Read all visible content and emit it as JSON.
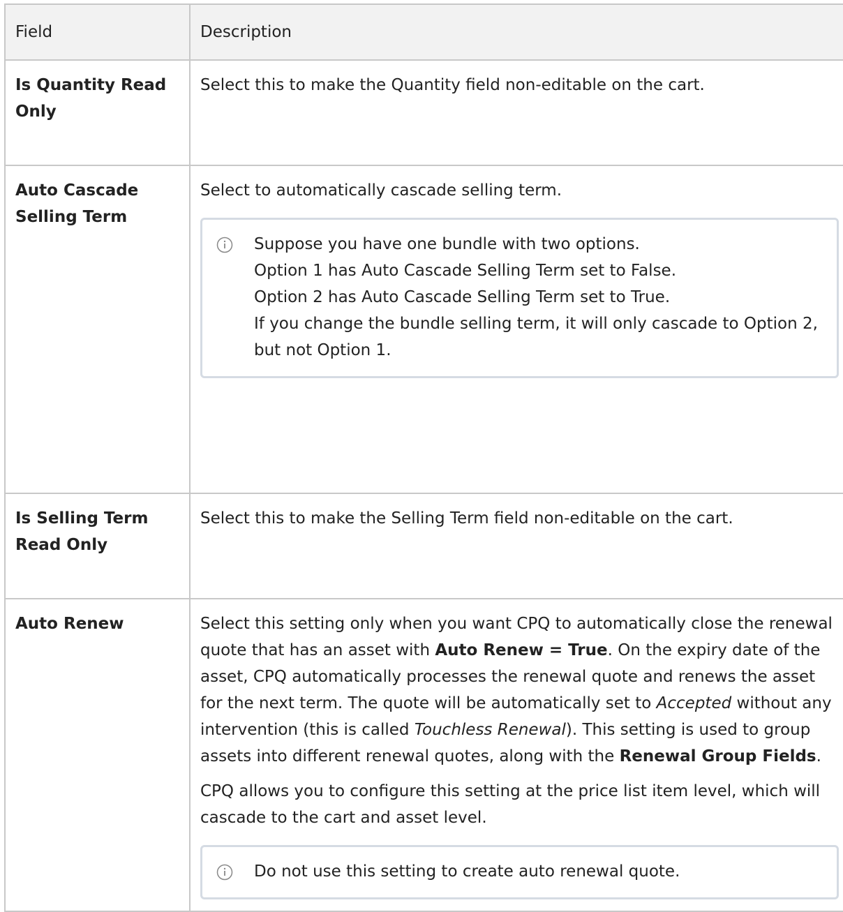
{
  "header": {
    "field": "Field",
    "description": "Description"
  },
  "rows": [
    {
      "field": "Is Quantity Read Only",
      "description": "Select this to make the Quantity field non-editable on the cart."
    },
    {
      "field": "Auto Cascade Selling Term",
      "description": "Select to automatically cascade selling term.",
      "note_lines": [
        "Suppose you have one bundle with two options.",
        "Option 1 has Auto Cascade Selling Term set to False.",
        "Option 2 has Auto Cascade Selling Term set to True.",
        "If you change the bundle selling term, it will only cascade to Option 2, but not Option 1."
      ]
    },
    {
      "field": "Is Selling Term Read Only",
      "description": "Select this to make the Selling Term field non-editable on the cart."
    },
    {
      "field": "Auto Renew",
      "para1": {
        "t1": "Select this setting only when you want CPQ to automatically close the renewal quote that has an asset with ",
        "b1": "Auto Renew = True",
        "t2": ". On the expiry date of the asset, CPQ automatically processes the renewal quote and renews the asset for the next term. The quote will be automatically set to ",
        "i1": "Accepted",
        "t3": " without any intervention (this is called ",
        "i2": "Touchless Renewal",
        "t4": "). This setting is used to group assets into different renewal quotes, along with the ",
        "b2": "Renewal Group Fields",
        "t5": "."
      },
      "para2": "CPQ allows you to configure this setting at the price list item level, which will cascade to the cart and asset level.",
      "note": "Do not use this setting to create auto renewal quote."
    }
  ],
  "icons": {
    "info": "info-icon"
  },
  "colors": {
    "border": "#c8c8c8",
    "header_bg": "#f2f2f2",
    "note_border": "#d5dbe3"
  }
}
